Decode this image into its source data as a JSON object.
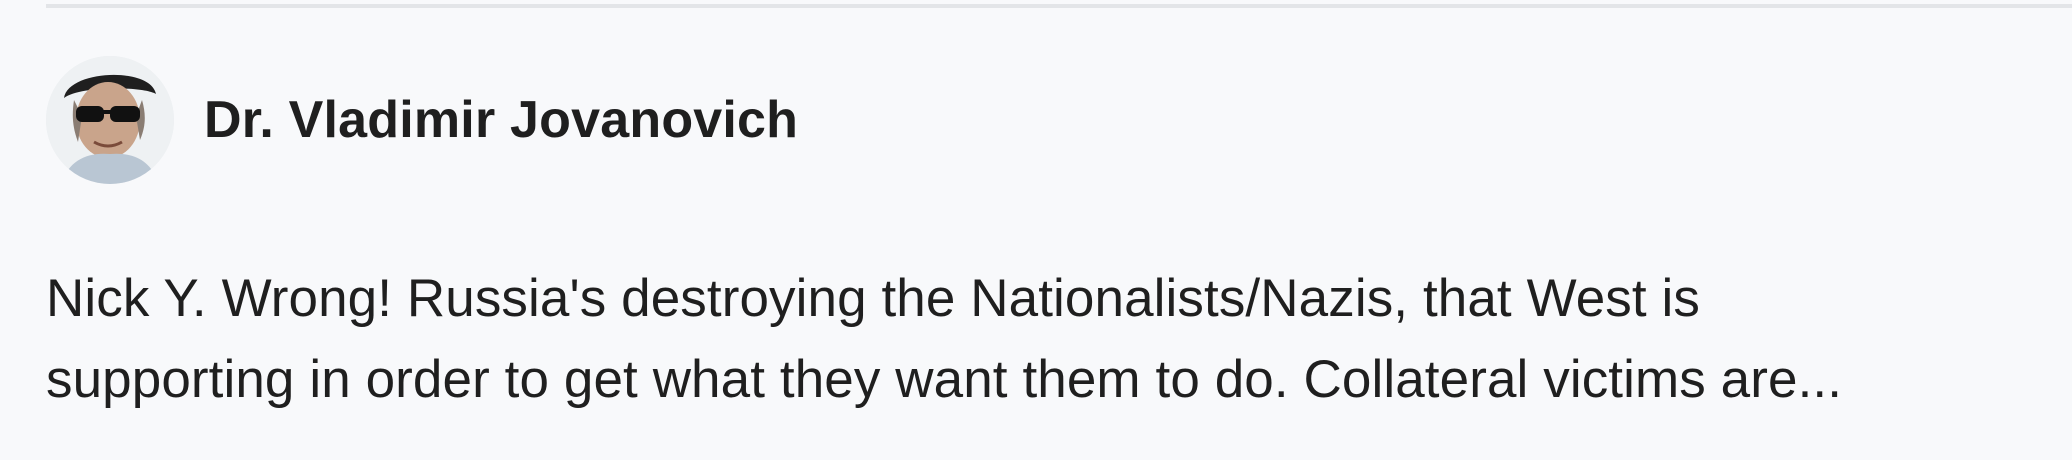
{
  "comment": {
    "author": {
      "name": "Dr. Vladimir Jovanovich",
      "avatar_icon": "user-avatar-photo"
    },
    "text_lines": [
      "Nick Y. Wrong! Russia's destroying the Nationalists/Nazis, that West is",
      "supporting in order to get what they want them to do. Collateral victims are..."
    ]
  },
  "colors": {
    "background": "#f8f9fb",
    "divider": "#e3e5e8",
    "text": "#1f1f1f"
  }
}
